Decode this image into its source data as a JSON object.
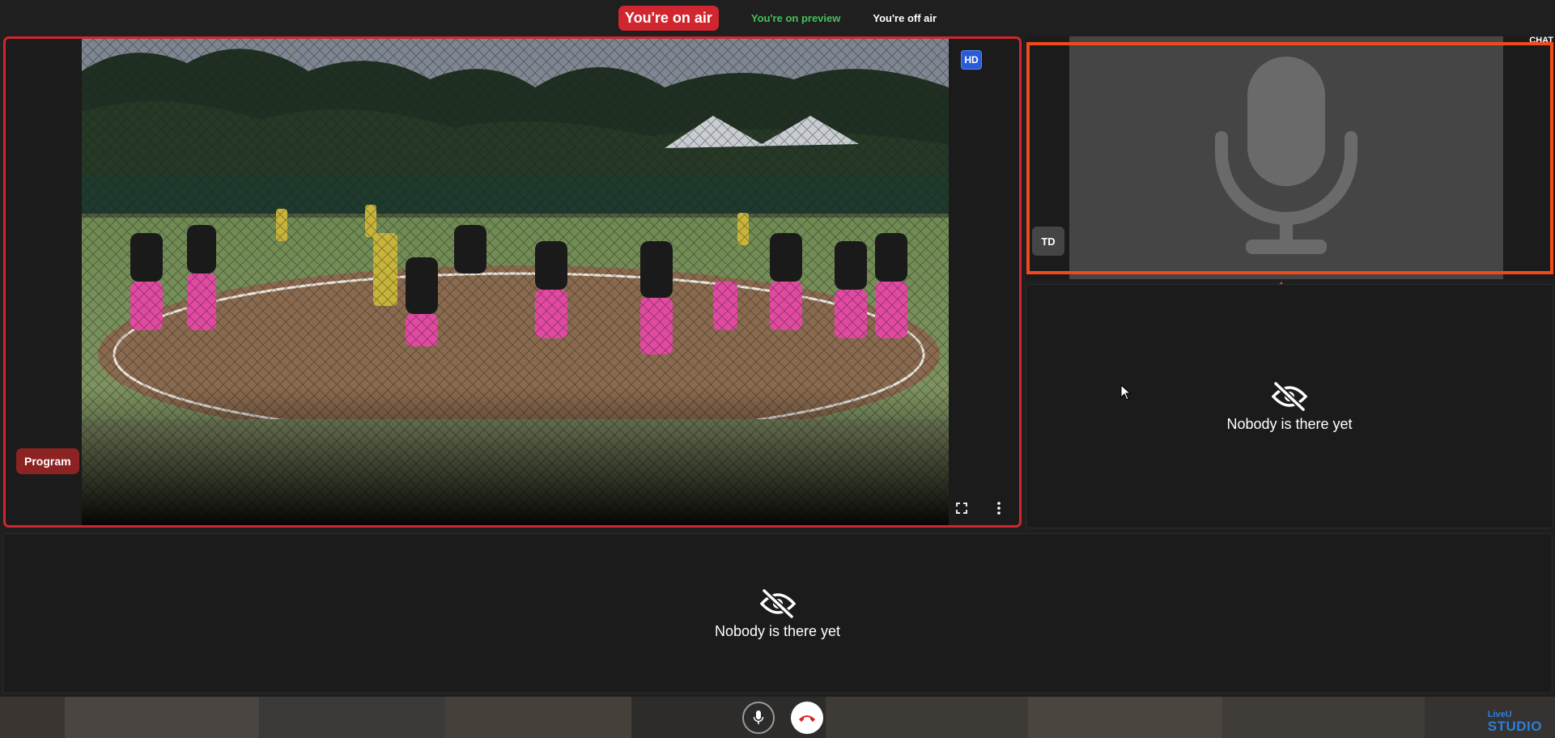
{
  "status_bar": {
    "on_air": "You're on air",
    "on_preview": "You're on preview",
    "off_air": "You're off air"
  },
  "program_tile": {
    "quality_badge": "HD",
    "label": "Program",
    "icons": [
      "fullscreen-icon",
      "more-vertical-icon"
    ]
  },
  "audio_tile": {
    "initials": "TD",
    "chat_tab": "CHAT",
    "icon": "microphone-icon"
  },
  "side_empty_tile": {
    "icon": "eye-slash-icon",
    "text": "Nobody is there yet"
  },
  "bottom_empty_tile": {
    "icon": "eye-slash-icon",
    "text": "Nobody is there yet"
  },
  "call_controls": {
    "icons": [
      "microphone-icon",
      "hang-up-icon"
    ]
  },
  "logo": {
    "small": "LiveU",
    "main": "STUDIO"
  },
  "colors": {
    "on_air_red": "#d0262f",
    "preview_green": "#44c15a",
    "hd_blue": "#2a5bd7",
    "highlight_orange": "#f04a1a",
    "program_label": "#8c2323",
    "brand_blue": "#2a7fdf"
  }
}
